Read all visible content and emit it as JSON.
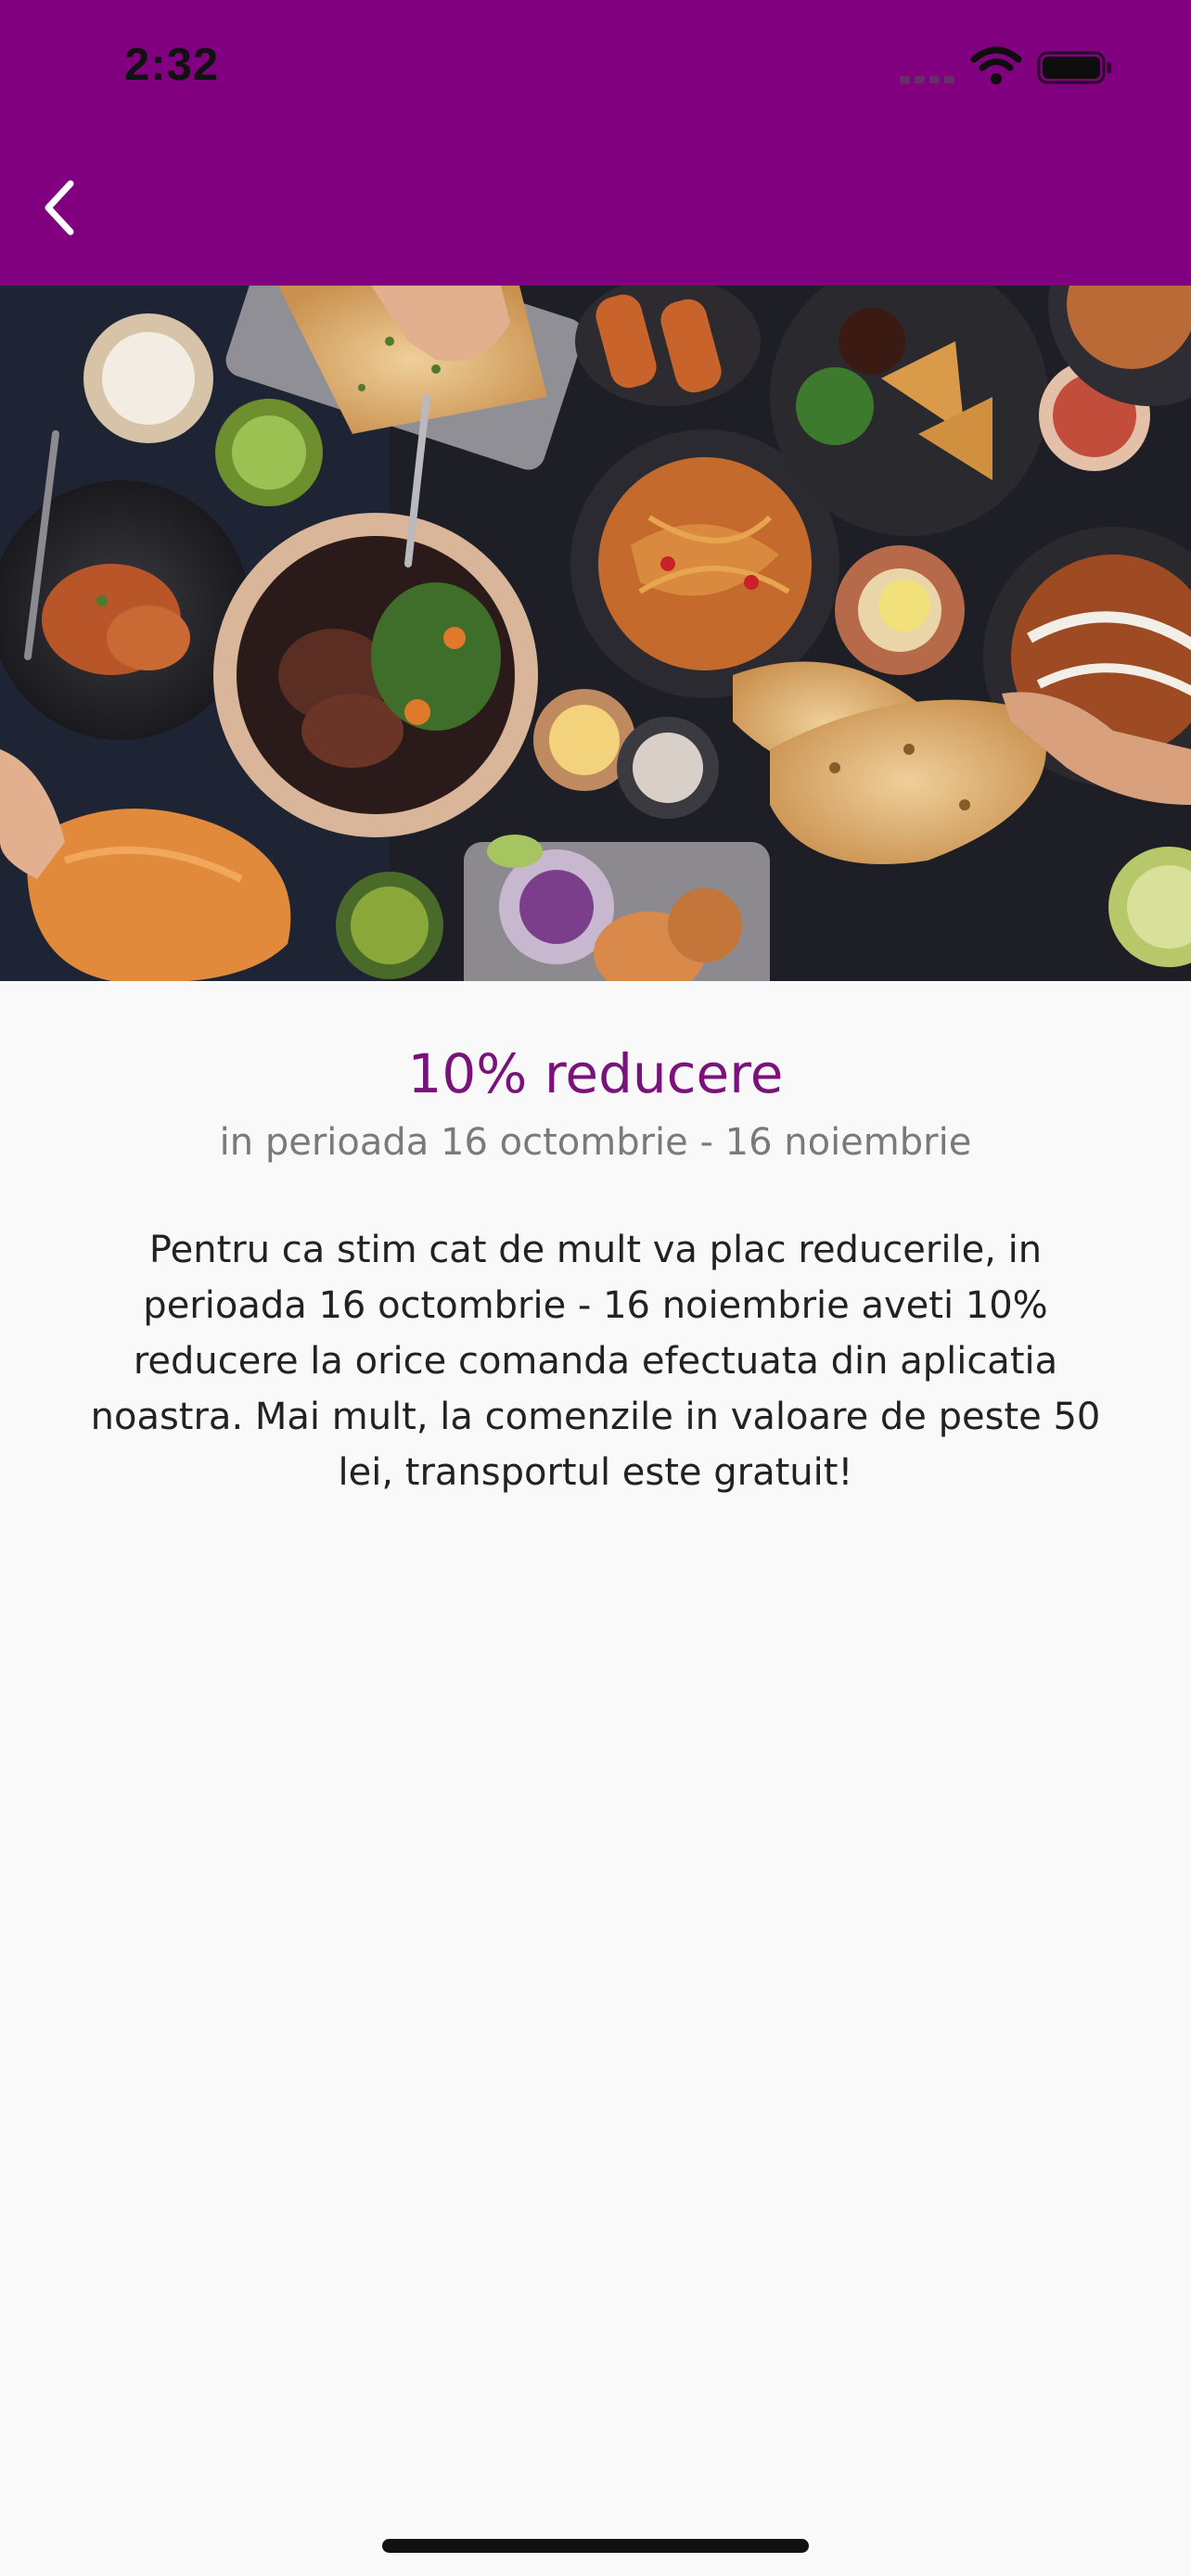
{
  "status_bar": {
    "time": "2:32",
    "signal_icon": "cellular-signal-icon",
    "wifi_icon": "wifi-icon",
    "battery_icon": "battery-full-icon"
  },
  "header": {
    "background_color": "#800080",
    "back_icon": "chevron-left-icon"
  },
  "hero": {
    "image": "food-spread-photo"
  },
  "offer": {
    "title": "10% reducere",
    "period": "in perioada 16 octombrie - 16 noiembrie",
    "description": "Pentru ca stim cat de mult va plac reducerile, in perioada 16 octombrie - 16 noiembrie aveti 10% reducere la orice comanda efectuata din aplicatia noastra. Mai mult, la comenzile in valoare de peste 50 lei, transportul este gratuit!"
  },
  "colors": {
    "accent": "#800080",
    "title": "#7b127b",
    "subtitle": "#7a7a7a",
    "body_text": "#222222",
    "background": "#f9f9f9"
  }
}
